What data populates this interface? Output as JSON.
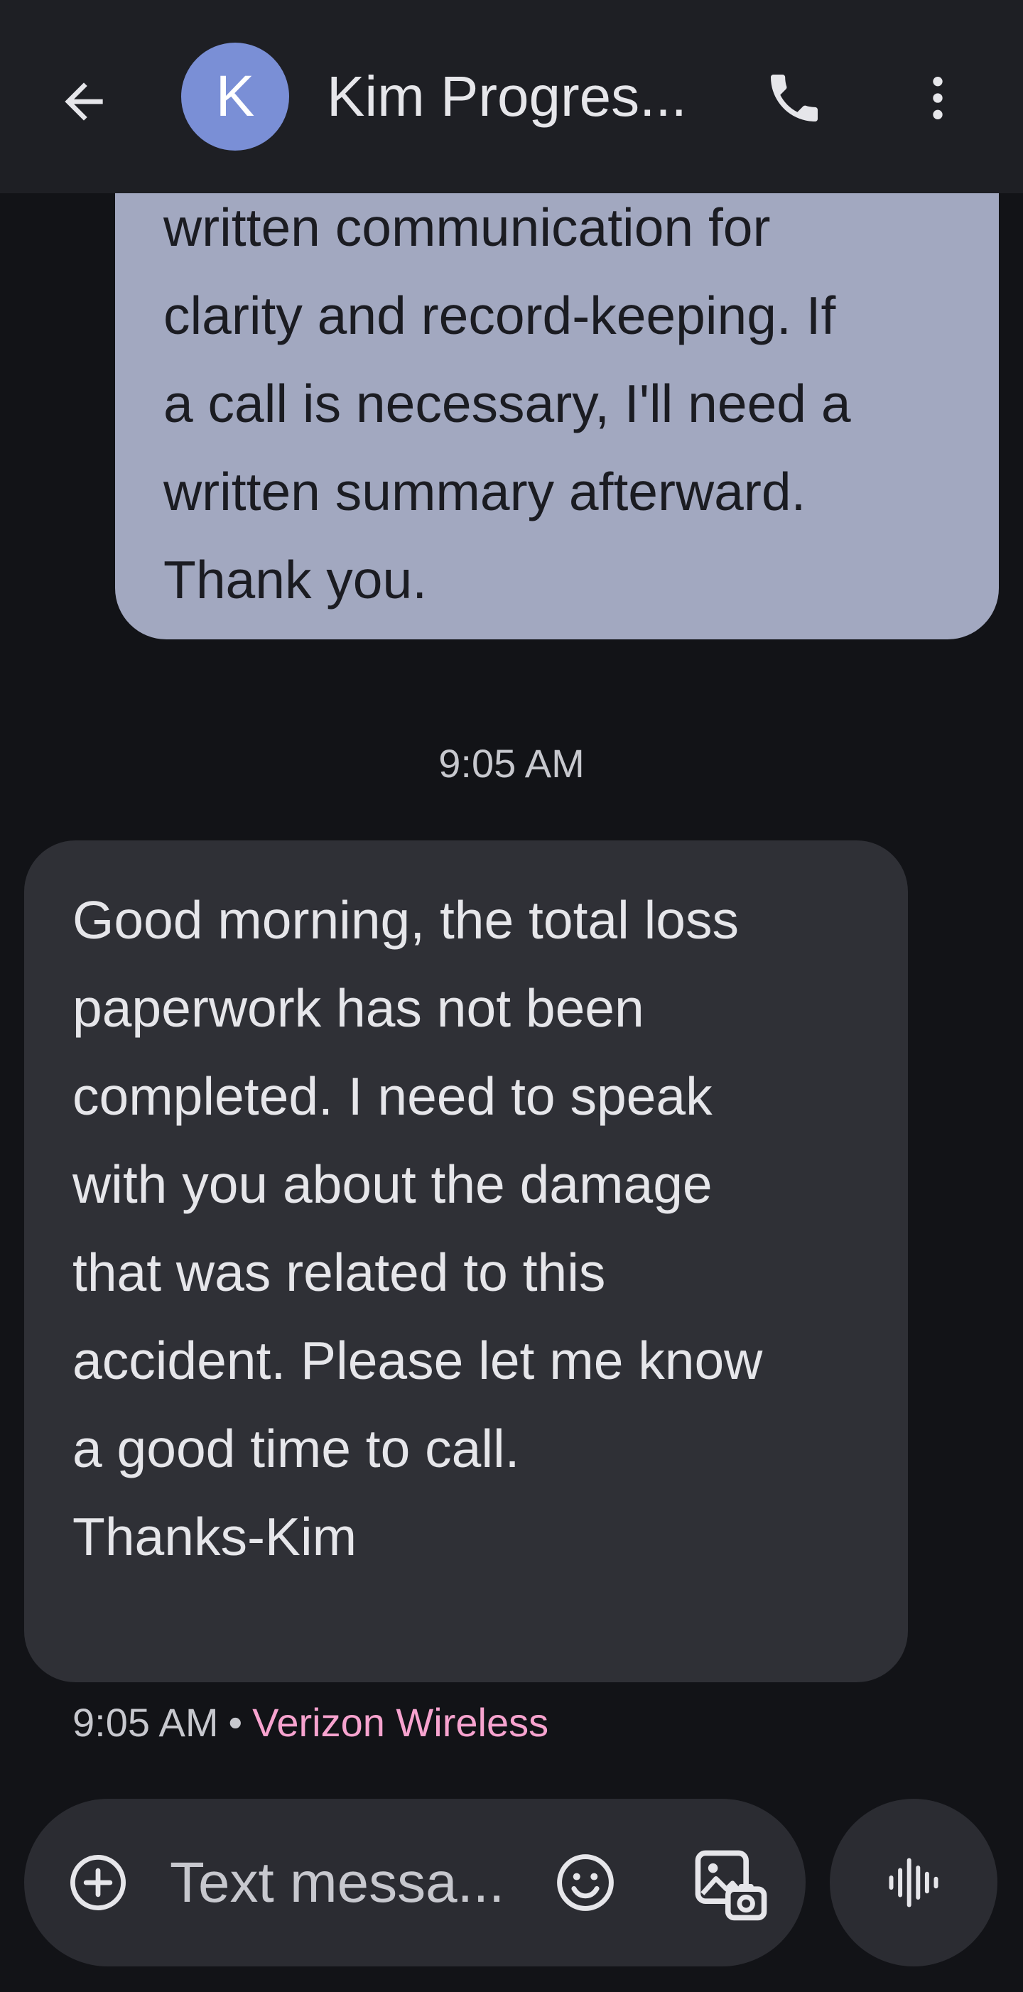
{
  "header": {
    "back_icon": "arrow-back-icon",
    "avatar_initial": "K",
    "avatar_color": "#7a8fd6",
    "contact_name": "Kim Progres...",
    "call_icon": "phone-icon",
    "more_icon": "more-vert-icon"
  },
  "messages": [
    {
      "direction": "outgoing",
      "text": "written communication for\nclarity and record-keeping. If\na call is necessary, I'll need a\nwritten summary afterward.\nThank you.",
      "bubble_color": "#a2a8c0"
    },
    {
      "direction": "incoming",
      "timestamp_header": "9:05 AM",
      "text": "Good morning, the total loss\npaperwork has not been\ncompleted. I need to speak\nwith you about the damage\nthat was related to this\naccident. Please let me know\na good time to call.\nThanks-Kim",
      "time": "9:05 AM",
      "separator": "•",
      "carrier": "Verizon Wireless",
      "carrier_color": "#f7a3cf",
      "bubble_color": "#2f3036"
    }
  ],
  "composer": {
    "add_icon": "add-circle-icon",
    "placeholder": "Text messa...",
    "emoji_icon": "emoji-icon",
    "gallery_icon": "gallery-icon",
    "voice_icon": "voice-waveform-icon"
  }
}
